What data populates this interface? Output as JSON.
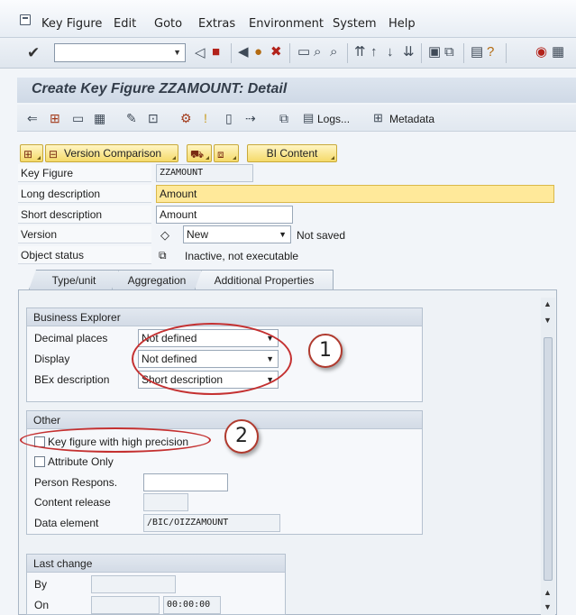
{
  "menu": {
    "items": [
      "Key Figure",
      "Edit",
      "Goto",
      "Extras",
      "Environment",
      "System",
      "Help"
    ]
  },
  "title": "Create Key Figure ZZAMOUNT: Detail",
  "app_toolbar": {
    "logs_label": "Logs...",
    "metadata_label": "Metadata"
  },
  "buttons": {
    "version_comparison": "Version Comparison",
    "bi_content": "BI Content"
  },
  "form": {
    "key_figure_label": "Key Figure",
    "key_figure_value": "ZZAMOUNT",
    "long_desc_label": "Long description",
    "long_desc_value": "Amount",
    "short_desc_label": "Short description",
    "short_desc_value": "Amount",
    "version_label": "Version",
    "version_value": "New",
    "version_status": "Not saved",
    "object_status_label": "Object status",
    "object_status_value": "Inactive, not executable"
  },
  "tabs": [
    "Type/unit",
    "Aggregation",
    "Additional Properties"
  ],
  "business_explorer": {
    "title": "Business Explorer",
    "decimal_places_label": "Decimal places",
    "decimal_places_value": "Not defined",
    "display_label": "Display",
    "display_value": "Not defined",
    "bex_desc_label": "BEx description",
    "bex_desc_value": "Short description"
  },
  "other": {
    "title": "Other",
    "high_precision_label": "Key figure with high precision",
    "attribute_only_label": "Attribute Only",
    "person_label": "Person Respons.",
    "content_release_label": "Content release",
    "data_element_label": "Data element",
    "data_element_value": "/BIC/OIZZAMOUNT"
  },
  "last_change": {
    "title": "Last change",
    "by_label": "By",
    "on_label": "On",
    "time_value": "00:00:00"
  },
  "annotations": [
    "1",
    "2"
  ],
  "colors": {
    "required_field": "#ffe99a",
    "button_yellow": "#f5da6a",
    "annotation_red": "#c43030"
  }
}
